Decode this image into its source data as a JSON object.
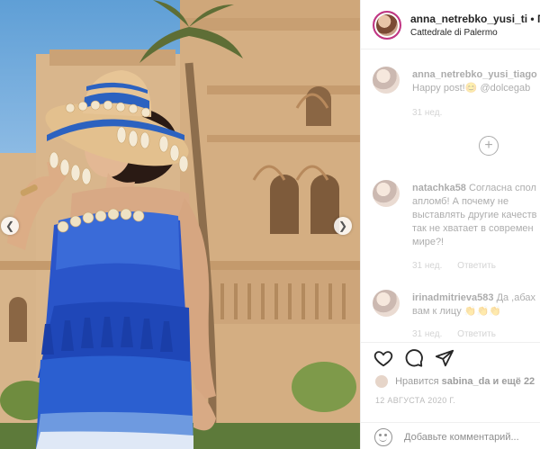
{
  "post": {
    "username": "anna_netrebko_yusi_ti",
    "follow_hint": "• По",
    "location": "Cattedrale di Palermo"
  },
  "comments": [
    {
      "username": "anna_netrebko_yusi_tiago",
      "line1": "",
      "line2": "Happy post!😊 @dolcegab",
      "time": "31 нед.",
      "reply": ""
    },
    {
      "username": "natachka58",
      "line1": "Согласна спол",
      "line2": "апломб! А почему не",
      "line3": "выставлять другие качеств",
      "line4": "так не хватает в современ",
      "line5": "мире?!",
      "time": "31 нед.",
      "reply": "Ответить"
    },
    {
      "username": "irinadmitrieva583",
      "line1": "Да ,абах",
      "line2": "вам к лицу 👏👏👏",
      "time": "31 нед.",
      "reply": "Ответить"
    }
  ],
  "actions": {
    "likes_prefix": "Нравится",
    "likes_user": "sabina_da",
    "likes_suffix": "и ещё 22",
    "date": "12 АВГУСТА 2020 Г."
  },
  "add_comment": {
    "placeholder": "Добавьте комментарий..."
  },
  "icons": [
    "chevron-left-icon",
    "chevron-right-icon",
    "heart-icon",
    "comment-icon",
    "share-icon",
    "plus-icon",
    "emoji-icon"
  ]
}
